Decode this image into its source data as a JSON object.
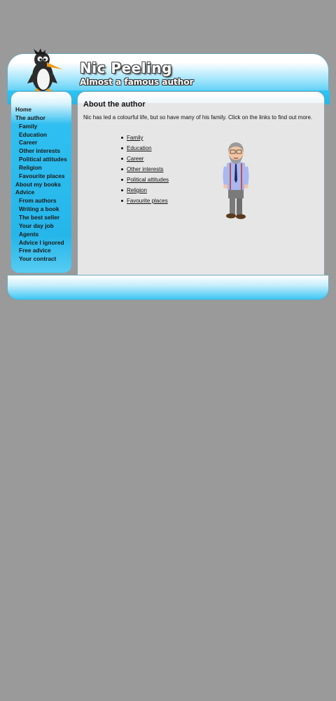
{
  "site": {
    "title": "Nic Peeling",
    "subtitle": "Almost a famous author"
  },
  "nav": {
    "items": [
      {
        "label": "Home",
        "sub": false
      },
      {
        "label": "The author",
        "sub": false
      },
      {
        "label": "Family",
        "sub": true
      },
      {
        "label": "Education",
        "sub": true
      },
      {
        "label": "Career",
        "sub": true
      },
      {
        "label": "Other interests",
        "sub": true
      },
      {
        "label": "Political attitudes",
        "sub": true
      },
      {
        "label": "Religion",
        "sub": true
      },
      {
        "label": "Favourite places",
        "sub": true
      },
      {
        "label": "About my books",
        "sub": false
      },
      {
        "label": "Advice",
        "sub": false
      },
      {
        "label": "From authors",
        "sub": true
      },
      {
        "label": "Writing a book",
        "sub": true
      },
      {
        "label": "The best seller",
        "sub": true
      },
      {
        "label": "Your day job",
        "sub": true
      },
      {
        "label": "Agents",
        "sub": true
      },
      {
        "label": "Advice I ignored",
        "sub": true
      },
      {
        "label": "Free advice",
        "sub": true
      },
      {
        "label": "Your contract",
        "sub": true
      }
    ]
  },
  "main": {
    "title": "About the author",
    "intro": "Nic has led a colourful life, but so have many of his family. Click on the links to find out more.",
    "links": [
      "Family",
      "Education",
      "Career",
      "Other interests",
      "Political attitudes",
      "Religion",
      "Favourite places"
    ]
  },
  "icons": {
    "logo": "penguin-icon",
    "author": "author-cartoon-icon"
  },
  "colors": {
    "accent": "#22bff2",
    "background": "#9a9a9a",
    "content": "#e6e6e6"
  }
}
